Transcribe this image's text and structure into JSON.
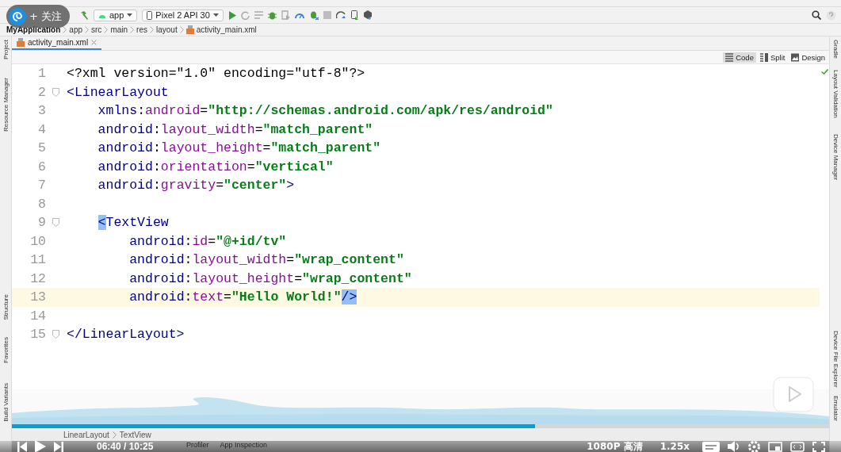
{
  "follow_button": {
    "label": "+ 关注"
  },
  "toolbar": {
    "run_config": "app",
    "device": "Pixel 2 API 30"
  },
  "breadcrumb": [
    "MyApplication",
    "app",
    "src",
    "main",
    "res",
    "layout",
    "activity_main.xml"
  ],
  "left_tool_windows": [
    "Project",
    "Resource Manager",
    "Structure",
    "Favorites",
    "Build Variants"
  ],
  "right_tool_windows": [
    "Gradle",
    "Layout Validation",
    "Device Manager",
    "Device File Explorer",
    "Emulator"
  ],
  "editor_tabs": [
    {
      "label": "activity_main.xml",
      "selected": true
    }
  ],
  "view_modes": [
    {
      "label": "Code",
      "selected": true
    },
    {
      "label": "Split",
      "selected": false
    },
    {
      "label": "Design",
      "selected": false
    }
  ],
  "code_lines": [
    {
      "number": "1",
      "current": false,
      "tokens": [
        {
          "text": "<?xml version=\"1.0\" encoding=\"utf-8\"?>",
          "kind": "punct"
        }
      ]
    },
    {
      "number": "2",
      "current": false,
      "tokens": [
        {
          "text": "<LinearLayout",
          "kind": "tag"
        }
      ]
    },
    {
      "number": "3",
      "current": false,
      "tokens": [
        {
          "text": "    xmlns",
          "kind": "ns"
        },
        {
          "text": ":",
          "kind": "punct"
        },
        {
          "text": "android",
          "kind": "attr"
        },
        {
          "text": "=",
          "kind": "punct"
        },
        {
          "text": "\"http://schemas.android.com/apk/res/android\"",
          "kind": "value"
        }
      ]
    },
    {
      "number": "4",
      "current": false,
      "tokens": [
        {
          "text": "    android",
          "kind": "ns"
        },
        {
          "text": ":",
          "kind": "punct"
        },
        {
          "text": "layout_width",
          "kind": "attr"
        },
        {
          "text": "=",
          "kind": "punct"
        },
        {
          "text": "\"match_parent\"",
          "kind": "value"
        }
      ]
    },
    {
      "number": "5",
      "current": false,
      "tokens": [
        {
          "text": "    android",
          "kind": "ns"
        },
        {
          "text": ":",
          "kind": "punct"
        },
        {
          "text": "layout_height",
          "kind": "attr"
        },
        {
          "text": "=",
          "kind": "punct"
        },
        {
          "text": "\"match_parent\"",
          "kind": "value"
        }
      ]
    },
    {
      "number": "6",
      "current": false,
      "tokens": [
        {
          "text": "    android",
          "kind": "ns"
        },
        {
          "text": ":",
          "kind": "punct"
        },
        {
          "text": "orientation",
          "kind": "attr"
        },
        {
          "text": "=",
          "kind": "punct"
        },
        {
          "text": "\"vertical\"",
          "kind": "value"
        }
      ]
    },
    {
      "number": "7",
      "current": false,
      "tokens": [
        {
          "text": "    android",
          "kind": "ns"
        },
        {
          "text": ":",
          "kind": "punct"
        },
        {
          "text": "gravity",
          "kind": "attr"
        },
        {
          "text": "=",
          "kind": "punct"
        },
        {
          "text": "\"center\"",
          "kind": "value"
        },
        {
          "text": ">",
          "kind": "tag"
        }
      ]
    },
    {
      "number": "8",
      "current": false
    },
    {
      "number": "9",
      "current": false,
      "tokens": [
        {
          "text": "    <",
          "kind": "match"
        },
        {
          "text": "TextView",
          "kind": "tag"
        }
      ]
    },
    {
      "number": "10",
      "current": false,
      "tokens": [
        {
          "text": "        android",
          "kind": "ns"
        },
        {
          "text": ":",
          "kind": "punct"
        },
        {
          "text": "id",
          "kind": "attr"
        },
        {
          "text": "=",
          "kind": "punct"
        },
        {
          "text": "\"@+id/tv\"",
          "kind": "value"
        }
      ]
    },
    {
      "number": "11",
      "current": false,
      "tokens": [
        {
          "text": "        android",
          "kind": "ns"
        },
        {
          "text": ":",
          "kind": "punct"
        },
        {
          "text": "layout_width",
          "kind": "attr"
        },
        {
          "text": "=",
          "kind": "punct"
        },
        {
          "text": "\"wrap_content\"",
          "kind": "value"
        }
      ]
    },
    {
      "number": "12",
      "current": false,
      "tokens": [
        {
          "text": "        android",
          "kind": "ns"
        },
        {
          "text": ":",
          "kind": "punct"
        },
        {
          "text": "layout_height",
          "kind": "attr"
        },
        {
          "text": "=",
          "kind": "punct"
        },
        {
          "text": "\"wrap_content\"",
          "kind": "value"
        }
      ]
    },
    {
      "number": "13",
      "current": true,
      "tokens": [
        {
          "text": "        android",
          "kind": "ns"
        },
        {
          "text": ":",
          "kind": "punct"
        },
        {
          "text": "text",
          "kind": "attr"
        },
        {
          "text": "=",
          "kind": "punct"
        },
        {
          "text": "\"Hello World!\"",
          "kind": "value"
        },
        {
          "text": "/>",
          "kind": "match"
        }
      ]
    },
    {
      "number": "14",
      "current": false
    },
    {
      "number": "15",
      "current": false,
      "tokens": [
        {
          "text": "</LinearLayout>",
          "kind": "tag"
        }
      ]
    }
  ],
  "structure_path": [
    "LinearLayout",
    "TextView"
  ],
  "bottom_tool_windows": [
    "Profiler",
    "App Inspection"
  ],
  "player": {
    "time": "06:40 / 10:25",
    "level": 0.64,
    "quality": "1080P 高清",
    "speed": "1.25x"
  }
}
